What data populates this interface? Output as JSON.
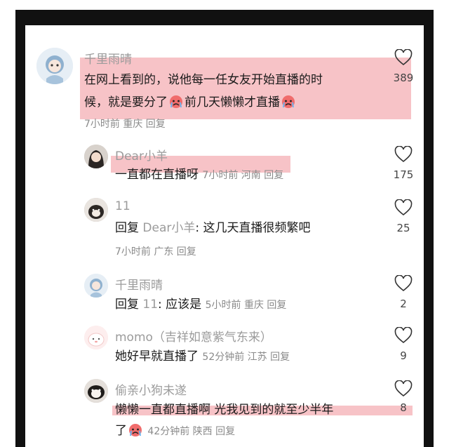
{
  "comments": [
    {
      "user": "千里雨晴",
      "lines": [
        "在网上看到的，说他每一任女友开始直播的时",
        "候，就是要分了",
        "前几天懒懒才直播"
      ],
      "meta": "7小时前 重庆 回复",
      "likes": "389",
      "avatar_icon": "cartoon-girl-avatar-icon"
    },
    {
      "user": "Dear小羊",
      "text": "一直都在直播呀",
      "meta": "7小时前 河南 回复",
      "likes": "175",
      "avatar_icon": "girl-photo-avatar-icon"
    },
    {
      "user": "11",
      "reply_word": "回复",
      "mention": "Dear小羊",
      "text": ": 这几天直播很频繁吧",
      "meta": "7小时前 广东 回复",
      "likes": "25",
      "avatar_icon": "dog-photo-avatar-icon"
    },
    {
      "user": "千里雨晴",
      "reply_word": "回复",
      "mention": "11",
      "text": ": 应该是",
      "meta": "5小时前 重庆 回复",
      "likes": "2",
      "avatar_icon": "cartoon-girl-avatar-icon"
    },
    {
      "user": "momo（吉祥如意紫气东来）",
      "text": "她好早就直播了",
      "meta": "52分钟前 江苏 回复",
      "likes": "9",
      "avatar_icon": "pink-bunny-avatar-icon"
    },
    {
      "user": "偷亲小狗未遂",
      "lines": [
        "懒懒一直都直播啊 光我见到的就至少半年",
        "了"
      ],
      "meta": "42分钟前 陕西 回复",
      "likes": "8",
      "avatar_icon": "puppy-photo-avatar-icon"
    }
  ],
  "colors": {
    "highlight": "#f6b8bd",
    "muted": "#8a8a8a",
    "text": "#1a1a1a"
  }
}
